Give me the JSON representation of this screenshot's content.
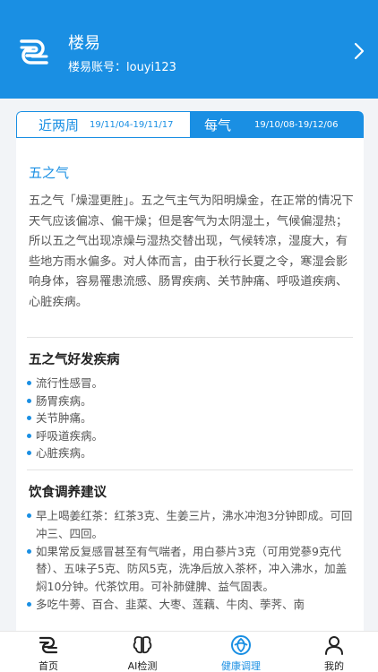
{
  "header": {
    "name": "楼易",
    "account": "楼易账号：louyi123"
  },
  "tabs": [
    {
      "title": "近两周",
      "date": "19/11/04-19/11/17",
      "active": false
    },
    {
      "title": "每气",
      "date": "19/10/08-19/12/06",
      "active": true
    }
  ],
  "article": {
    "title": "五之气",
    "paragraph": "五之气「燥湿更胜」。五之气主气为阳明燥金，在正常的情况下天气应该偏凉、偏干燥；但是客气为太阴湿土，气候偏湿热；所以五之气出现凉燥与湿热交替出现，气候转凉，湿度大，有些地方雨水偏多。对人体而言，由于秋行长夏之令，寒湿会影响身体，容易罹患流感、肠胃疾病、关节肿痛、呼吸道疾病、心脏疾病。"
  },
  "diseases": {
    "title": "五之气好发疾病",
    "items": [
      "流行性感冒。",
      "肠胃疾病。",
      "关节肿痛。",
      "呼吸道疾病。",
      "心脏疾病。"
    ]
  },
  "diet": {
    "title": "饮食调养建议",
    "items": [
      "早上喝姜红茶：红茶3克、生姜三片，沸水冲泡3分钟即成。可回冲三、四回。",
      "如果常反复感冒甚至有气喘者，用白蔘片3克（可用党蔘9克代替）、五味子5克、防风5克，洗净后放入茶杯，冲入沸水，加盖焖10分钟。代茶饮用。可补肺健脾、益气固表。",
      "多吃牛蒡、百合、韭菜、大枣、莲藕、牛肉、荸荠、南"
    ]
  },
  "nav": [
    {
      "label": "首页",
      "icon": "logo-home-icon"
    },
    {
      "label": "AI检测",
      "icon": "ai-detect-icon"
    },
    {
      "label": "健康调理",
      "icon": "health-care-icon",
      "active": true
    },
    {
      "label": "我的",
      "icon": "user-profile-icon"
    }
  ],
  "colors": {
    "primary": "#1a8fe3",
    "background": "#f2f4f7"
  }
}
